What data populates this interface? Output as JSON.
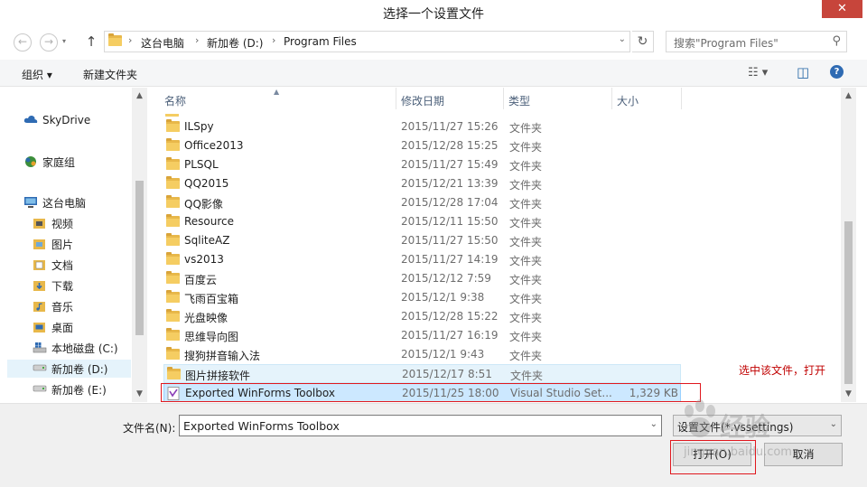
{
  "window": {
    "title": "选择一个设置文件",
    "close_glyph": "✕"
  },
  "address": {
    "crumbs": [
      "这台电脑",
      "新加卷 (D:)",
      "Program Files"
    ],
    "search_placeholder": "搜索\"Program Files\""
  },
  "toolbar": {
    "organize": "组织 ▾",
    "new_folder": "新建文件夹"
  },
  "nav": {
    "items": [
      {
        "label": "SkyDrive",
        "icon": "cloud-icon"
      },
      {
        "label": "家庭组",
        "icon": "homegroup-icon"
      },
      {
        "label": "这台电脑",
        "icon": "computer-icon"
      },
      {
        "label": "视频",
        "icon": "videos-folder-icon"
      },
      {
        "label": "图片",
        "icon": "pictures-folder-icon"
      },
      {
        "label": "文档",
        "icon": "documents-folder-icon"
      },
      {
        "label": "下载",
        "icon": "downloads-folder-icon"
      },
      {
        "label": "音乐",
        "icon": "music-folder-icon"
      },
      {
        "label": "桌面",
        "icon": "desktop-folder-icon"
      },
      {
        "label": "本地磁盘 (C:)",
        "icon": "system-drive-icon"
      },
      {
        "label": "新加卷 (D:)",
        "icon": "drive-icon"
      },
      {
        "label": "新加卷 (E:)",
        "icon": "drive-icon"
      }
    ]
  },
  "columns": {
    "name": "名称",
    "date": "修改日期",
    "type": "类型",
    "size": "大小"
  },
  "files": [
    {
      "name": "ILSpy",
      "date": "2015/11/27 15:26",
      "type": "文件夹",
      "size": ""
    },
    {
      "name": "Office2013",
      "date": "2015/12/28 15:25",
      "type": "文件夹",
      "size": ""
    },
    {
      "name": "PLSQL",
      "date": "2015/11/27 15:49",
      "type": "文件夹",
      "size": ""
    },
    {
      "name": "QQ2015",
      "date": "2015/12/21 13:39",
      "type": "文件夹",
      "size": ""
    },
    {
      "name": "QQ影像",
      "date": "2015/12/28 17:04",
      "type": "文件夹",
      "size": ""
    },
    {
      "name": "Resource",
      "date": "2015/12/11 15:50",
      "type": "文件夹",
      "size": ""
    },
    {
      "name": "SqliteAZ",
      "date": "2015/11/27 15:50",
      "type": "文件夹",
      "size": ""
    },
    {
      "name": "vs2013",
      "date": "2015/11/27 14:19",
      "type": "文件夹",
      "size": ""
    },
    {
      "name": "百度云",
      "date": "2015/12/12 7:59",
      "type": "文件夹",
      "size": ""
    },
    {
      "name": "飞雨百宝箱",
      "date": "2015/12/1 9:38",
      "type": "文件夹",
      "size": ""
    },
    {
      "name": "光盘映像",
      "date": "2015/12/28 15:22",
      "type": "文件夹",
      "size": ""
    },
    {
      "name": "思维导向图",
      "date": "2015/11/27 16:19",
      "type": "文件夹",
      "size": ""
    },
    {
      "name": "搜狗拼音输入法",
      "date": "2015/12/1 9:43",
      "type": "文件夹",
      "size": ""
    },
    {
      "name": "图片拼接软件",
      "date": "2015/12/17 8:51",
      "type": "文件夹",
      "size": ""
    },
    {
      "name": "Exported WinForms Toolbox",
      "date": "2015/11/25 18:00",
      "type": "Visual Studio Set...",
      "size": "1,329 KB"
    }
  ],
  "annotation": "选中该文件，打开",
  "bottom": {
    "filename_label": "文件名(N):",
    "filename_value": "Exported WinForms Toolbox",
    "filter_value": "设置文件(*.vssettings)",
    "open_button": "打开(O)",
    "cancel_button": "取消"
  },
  "watermark": {
    "brand": "经验",
    "url": "jingyan.baidu.com"
  }
}
